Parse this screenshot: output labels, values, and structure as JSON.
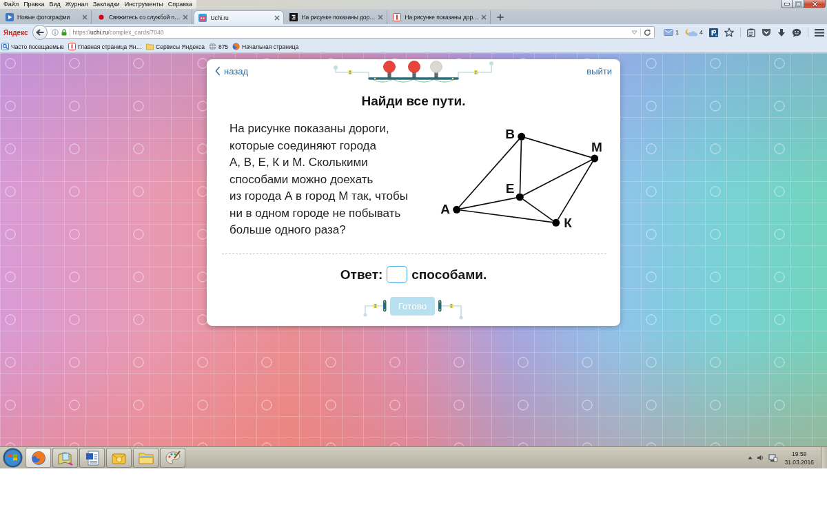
{
  "browser": {
    "menu": [
      "Файл",
      "Правка",
      "Вид",
      "Журнал",
      "Закладки",
      "Инструменты",
      "Справка"
    ],
    "tabs": [
      {
        "kind": "video",
        "title": "Новые фотографии",
        "selected": false
      },
      {
        "kind": "dot",
        "title": "Свяжитесь со службой п…",
        "selected": false
      },
      {
        "kind": "site",
        "title": "Uchi.ru",
        "selected": true
      },
      {
        "kind": "dark",
        "title": "На рисунке показаны дор…",
        "selected": false
      },
      {
        "kind": "yandex",
        "title": "На рисунке показаны дор…",
        "selected": false
      }
    ],
    "brand": "Яндекс",
    "url": {
      "scheme": "https://",
      "host": "uchi.ru",
      "path": "/complex_cards/7040"
    },
    "mail_count": "1",
    "weather": "4",
    "bookmarks": [
      {
        "kind": "history",
        "label": "Часто посещаемые"
      },
      {
        "kind": "yandex",
        "label": "Главная страница Ян…"
      },
      {
        "kind": "folder",
        "label": "Сервисы Яндекса"
      },
      {
        "kind": "globe",
        "label": "875"
      },
      {
        "kind": "firefox",
        "label": "Начальная страница"
      }
    ]
  },
  "card": {
    "back": "назад",
    "exit": "выйти",
    "progress": [
      {
        "lit": true
      },
      {
        "lit": true
      },
      {
        "lit": false
      }
    ],
    "title": "Найди все пути.",
    "question": [
      "На рисунке показаны дороги,",
      "которые соединяют города",
      "А, В, Е, К и М. Сколькими",
      "способами можно доехать",
      "из города А в город М так, чтобы",
      "ни в одном городе не побывать",
      "больше одного раза?"
    ],
    "graph": {
      "nodes": [
        {
          "label": "А"
        },
        {
          "label": "В"
        },
        {
          "label": "Е"
        },
        {
          "label": "К"
        },
        {
          "label": "М"
        }
      ]
    },
    "answer": {
      "label": "Ответ:",
      "unit": "способами."
    },
    "submit": {
      "label": "Готово",
      "disabled": true
    }
  },
  "taskbar": {
    "apps": [
      {
        "kind": "browser",
        "selected": true
      },
      {
        "kind": "notebook",
        "selected": false
      },
      {
        "kind": "document",
        "selected": false
      },
      {
        "kind": "mail",
        "selected": false
      },
      {
        "kind": "folder",
        "selected": false
      },
      {
        "kind": "paint",
        "selected": false
      }
    ],
    "time": "19:59",
    "date": "31.03.2016"
  }
}
